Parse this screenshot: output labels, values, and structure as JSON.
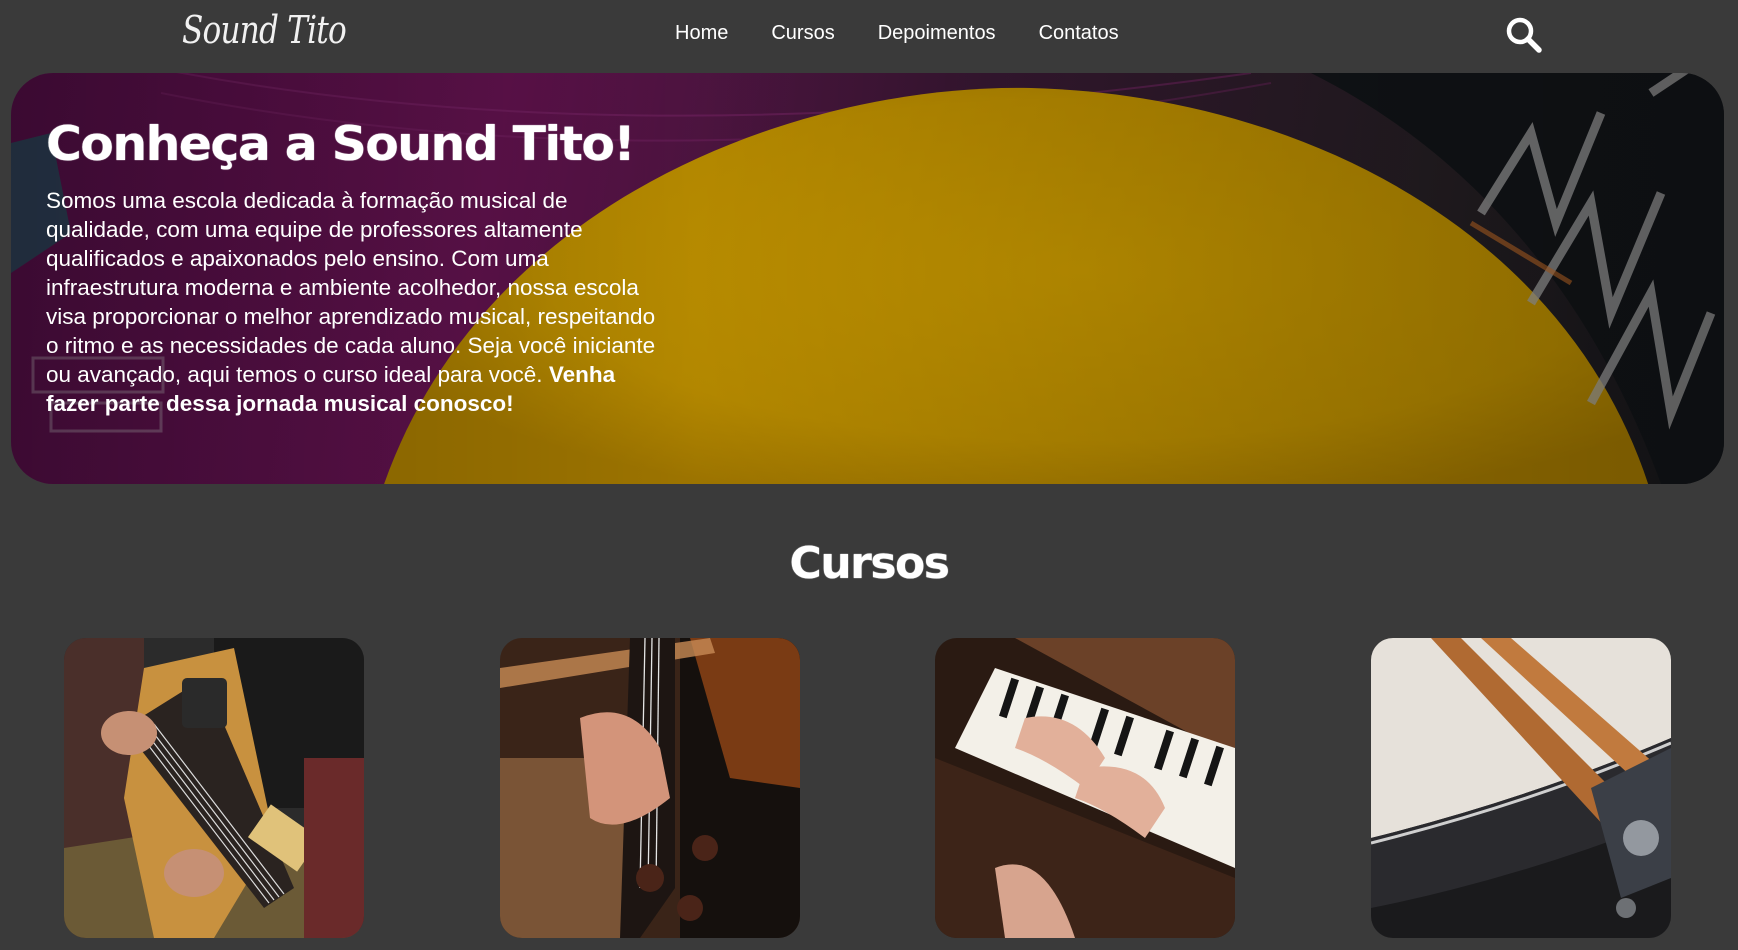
{
  "header": {
    "logo_text": "Sound Tito",
    "nav": [
      {
        "label": "Home"
      },
      {
        "label": "Cursos"
      },
      {
        "label": "Depoimentos"
      },
      {
        "label": "Contatos"
      }
    ],
    "search_icon": "search-icon"
  },
  "hero": {
    "title": "Conheça a Sound Tito!",
    "text": "Somos uma escola dedicada à formação musical de qualidade, com uma equipe de professores altamente qualificados e apaixonados pelo ensino. Com uma infraestrutura moderna e ambiente acolhedor, nossa escola visa proporcionar o melhor aprendizado musical, respeitando o ritmo e as necessidades de cada aluno. Seja você iniciante ou avançado, aqui temos o curso ideal para você.",
    "text_bold": "Venha fazer parte dessa jornada musical conosco!"
  },
  "courses": {
    "title": "Cursos",
    "items": [
      {
        "name": "guitar-course-image"
      },
      {
        "name": "violin-course-image"
      },
      {
        "name": "piano-course-image"
      },
      {
        "name": "drums-course-image"
      }
    ]
  },
  "colors": {
    "background": "#3a3a3a",
    "hero_magenta": "#6d1457",
    "hero_yellow": "#d9a400",
    "text": "#ffffff"
  }
}
